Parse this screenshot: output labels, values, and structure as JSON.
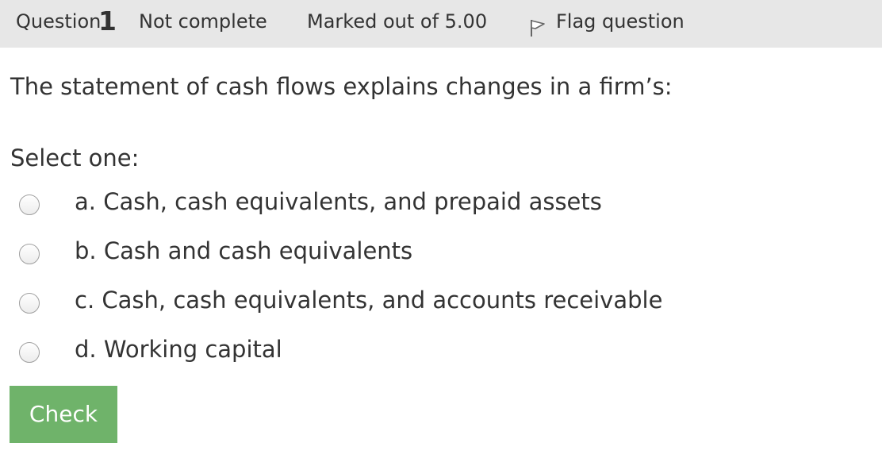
{
  "info": {
    "question_word": "Question",
    "question_number": "1",
    "state": "Not complete",
    "grade": "Marked out of 5.00",
    "flag_label": "Flag question",
    "flag_icon": "flag-icon"
  },
  "question": {
    "text": "The statement of cash flows explains changes in a firm’s:",
    "prompt": "Select one:",
    "answers": [
      {
        "label": "a. Cash, cash equivalents, and prepaid assets"
      },
      {
        "label": "b. Cash and cash equivalents"
      },
      {
        "label": "c. Cash, cash equivalents, and accounts receivable"
      },
      {
        "label": "d. Working capital"
      }
    ]
  },
  "actions": {
    "check_label": "Check",
    "check_color": "#6fb36a"
  },
  "colors": {
    "info_bar": "#e7e7e7",
    "text": "#333333"
  }
}
